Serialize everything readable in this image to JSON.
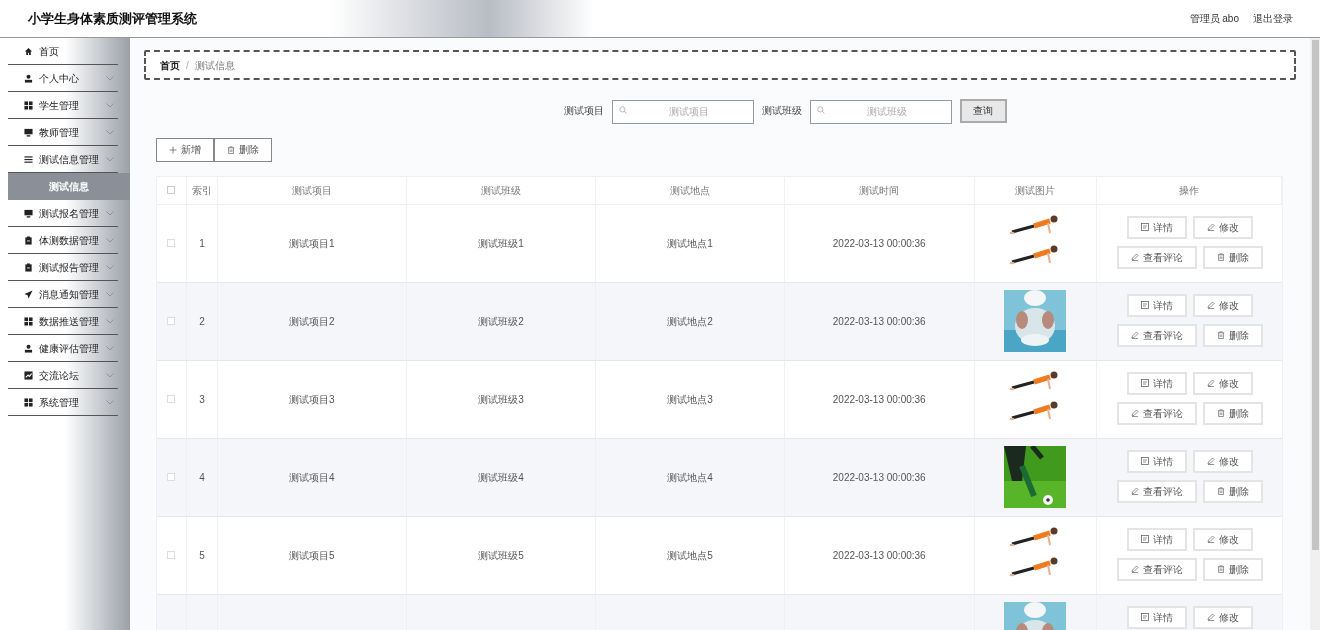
{
  "header": {
    "title": "小学生身体素质测评管理系统",
    "user": "管理员 abo",
    "logout": "退出登录"
  },
  "sidebar": {
    "items": [
      {
        "label": "首页"
      },
      {
        "label": "个人中心"
      },
      {
        "label": "学生管理"
      },
      {
        "label": "教师管理"
      },
      {
        "label": "测试信息管理",
        "children": [
          {
            "label": "测试信息",
            "selected": true
          }
        ]
      },
      {
        "label": "测试报名管理"
      },
      {
        "label": "体测数据管理"
      },
      {
        "label": "测试报告管理"
      },
      {
        "label": "消息通知管理"
      },
      {
        "label": "数据推送管理"
      },
      {
        "label": "健康评估管理"
      },
      {
        "label": "交流论坛"
      },
      {
        "label": "系统管理"
      }
    ]
  },
  "breadcrumb": {
    "separator": "/",
    "items": [
      "首页",
      "测试信息"
    ]
  },
  "search": {
    "fields": [
      {
        "label": "测试项目",
        "placeholder": "测试项目"
      },
      {
        "label": "测试班级",
        "placeholder": "测试班级"
      }
    ],
    "button": "查询"
  },
  "toolbar": [
    {
      "label": "新增",
      "kind": "add"
    },
    {
      "label": "删除",
      "kind": "delete"
    }
  ],
  "table": {
    "header_checked": false,
    "columns": [
      "索引",
      "测试项目",
      "测试班级",
      "测试地点",
      "测试时间",
      "测试图片",
      "操作"
    ],
    "rows": [
      {
        "checked": false,
        "index": "1",
        "item": "测试项目1",
        "class": "测试班级1",
        "place": "测试地点1",
        "time": "2022-03-13 00:00:36",
        "actions": [
          {
            "label": "详情",
            "kind": "detail"
          },
          {
            "label": "修改",
            "kind": "edit"
          },
          {
            "label": "查看评论",
            "kind": "edit"
          },
          {
            "label": "删除",
            "kind": "delete"
          }
        ]
      },
      {
        "checked": false,
        "index": "2",
        "item": "测试项目2",
        "class": "测试班级2",
        "place": "测试地点2",
        "time": "2022-03-13 00:00:36",
        "actions": [
          {
            "label": "详情",
            "kind": "detail"
          },
          {
            "label": "修改",
            "kind": "edit"
          },
          {
            "label": "查看评论",
            "kind": "edit"
          },
          {
            "label": "删除",
            "kind": "delete"
          }
        ]
      },
      {
        "checked": false,
        "index": "3",
        "item": "测试项目3",
        "class": "测试班级3",
        "place": "测试地点3",
        "time": "2022-03-13 00:00:36",
        "actions": [
          {
            "label": "详情",
            "kind": "detail"
          },
          {
            "label": "修改",
            "kind": "edit"
          },
          {
            "label": "查看评论",
            "kind": "edit"
          },
          {
            "label": "删除",
            "kind": "delete"
          }
        ]
      },
      {
        "checked": false,
        "index": "4",
        "item": "测试项目4",
        "class": "测试班级4",
        "place": "测试地点4",
        "time": "2022-03-13 00:00:36",
        "actions": [
          {
            "label": "详情",
            "kind": "detail"
          },
          {
            "label": "修改",
            "kind": "edit"
          },
          {
            "label": "查看评论",
            "kind": "edit"
          },
          {
            "label": "删除",
            "kind": "delete"
          }
        ]
      },
      {
        "checked": false,
        "index": "5",
        "item": "测试项目5",
        "class": "测试班级5",
        "place": "测试地点5",
        "time": "2022-03-13 00:00:36",
        "actions": [
          {
            "label": "详情",
            "kind": "detail"
          },
          {
            "label": "修改",
            "kind": "edit"
          },
          {
            "label": "查看评论",
            "kind": "edit"
          },
          {
            "label": "删除",
            "kind": "delete"
          }
        ]
      },
      {
        "actions": [
          {
            "label": "详情",
            "kind": "detail"
          },
          {
            "label": "修改",
            "kind": "edit"
          }
        ]
      }
    ]
  }
}
